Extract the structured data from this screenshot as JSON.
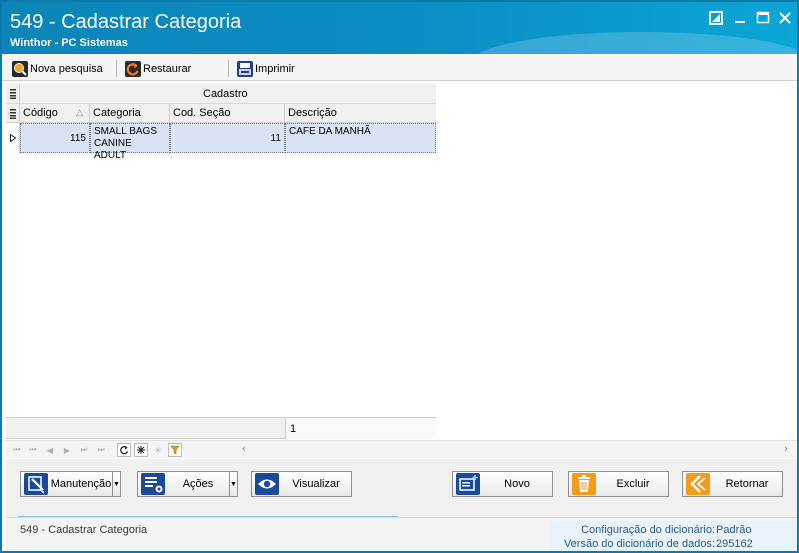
{
  "window": {
    "title": "549 - Cadastrar Categoria",
    "subtitle": "Winthor - PC Sistemas"
  },
  "toolbar": {
    "new_search": "Nova pesquisa",
    "restore": "Restaurar",
    "print": "Imprimir"
  },
  "grid": {
    "band": "Cadastro",
    "columns": [
      "Código",
      "Categoria",
      "Cod. Seção",
      "Descrição"
    ],
    "rows": [
      {
        "codigo": "115",
        "categoria_line1": "SMALL BAGS",
        "categoria_line2": "CANINE ADULT",
        "cod_secao": "11",
        "descricao": "CAFE DA MANHÃ"
      }
    ],
    "footer_count": "1"
  },
  "actions": {
    "manutencao": "Manutenção",
    "acoes": "Ações",
    "visualizar": "Visualizar",
    "novo": "Novo",
    "excluir": "Excluir",
    "retornar": "Retornar"
  },
  "status": {
    "left": "549 - Cadastrar Categoria",
    "dict_config_label": "Configuração do dicionário:",
    "dict_config_value": "Padrão",
    "dict_version_label": "Versão do dicionário de dados:",
    "dict_version_value": "295162"
  },
  "colors": {
    "titlebar": "#0b85b8",
    "selection": "#d8e4f3",
    "status_text": "#2c5f8a"
  }
}
